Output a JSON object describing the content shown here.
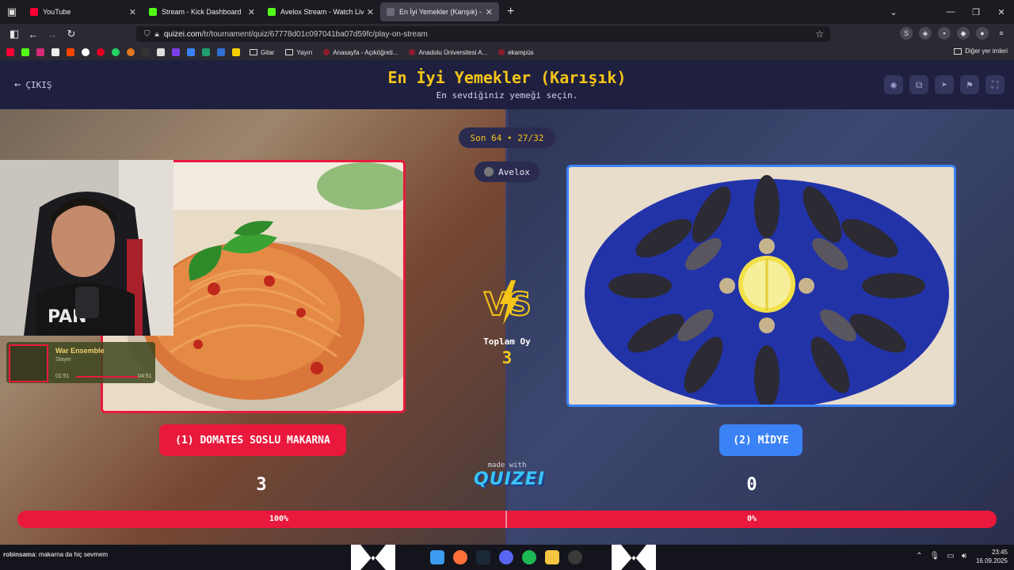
{
  "browser": {
    "tabs": [
      {
        "title": "YouTube",
        "color": "#ff0033"
      },
      {
        "title": "Stream - Kick Dashboard",
        "color": "#53fc18"
      },
      {
        "title": "Avelox Stream - Watch Live on Kick",
        "color": "#53fc18"
      },
      {
        "title": "En İyi Yemekler (Karışık) - Quizei",
        "color": "#6b6b7a",
        "active": true
      }
    ],
    "url_host": "quizei.com",
    "url_path": "/tr/tournament/quiz/67778d01c097041ba07d59fc/play-on-stream",
    "bookmarks": [
      {
        "label": "Gitar",
        "type": "folder"
      },
      {
        "label": "Yayın",
        "type": "folder"
      },
      {
        "label": "Anasayfa - Açıköğreti...",
        "type": "site"
      },
      {
        "label": "Anadolu Üniversitesi A...",
        "type": "site"
      },
      {
        "label": "ekampüs",
        "type": "site"
      }
    ],
    "other_bookmarks": "Diğer yer imleri"
  },
  "quiz": {
    "exit_label": "ÇIKIŞ",
    "title": "En İyi Yemekler (Karışık)",
    "subtitle": "En sevdiğiniz yemeği seçin.",
    "round": "Son 64 • 27/32",
    "streamer": "Avelox",
    "vs": "VS",
    "total_label": "Toplam Oy",
    "total_value": "3",
    "left_option": "(1) DOMATES SOSLU MAKARNA",
    "right_option": "(2) MİDYE",
    "left_votes": "3",
    "right_votes": "0",
    "left_percent_label": "100%",
    "right_percent_label": "0%",
    "left_share": 1.0,
    "made_with": "made with",
    "brand": "QUIZEI",
    "left_color": "#e8193c",
    "right_color": "#3b82f6",
    "accent": "#f5c518"
  },
  "overlay": {
    "song_title": "War Ensemble",
    "artist": "Slayer",
    "elapsed": "01:51",
    "duration": "04:51"
  },
  "taskbar": {
    "chat_user": "robinsama",
    "chat_text": ": makarna da hiç sevmem",
    "time": "23:45",
    "date": "16.09.2025"
  }
}
